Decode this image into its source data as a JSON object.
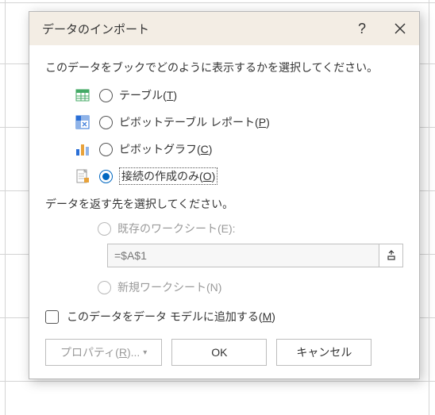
{
  "titlebar": {
    "title": "データのインポート",
    "help_label": "?",
    "close_label": "×"
  },
  "display_prompt": "このデータをブックでどのように表示するかを選択してください。",
  "options": {
    "table": {
      "label": "テーブル(",
      "key": "T",
      "suffix": ")"
    },
    "pivot_table": {
      "label": "ピボットテーブル レポート(",
      "key": "P",
      "suffix": ")"
    },
    "pivot_chart": {
      "label": "ピボットグラフ(",
      "key": "C",
      "suffix": ")"
    },
    "connection_only": {
      "label": "接続の作成のみ(",
      "key": "O",
      "suffix": ")"
    }
  },
  "dest_prompt": "データを返す先を選択してください。",
  "dest": {
    "existing": {
      "label": "既存のワークシート(E):",
      "value": "=$A$1"
    },
    "new": {
      "label": "新規ワークシート(N)"
    }
  },
  "add_model": {
    "label": "このデータをデータ モデルに追加する(",
    "key": "M",
    "suffix": ")"
  },
  "buttons": {
    "properties": {
      "label": "プロパティ(",
      "key": "R",
      "suffix": ")..."
    },
    "ok": "OK",
    "cancel": "キャンセル"
  }
}
